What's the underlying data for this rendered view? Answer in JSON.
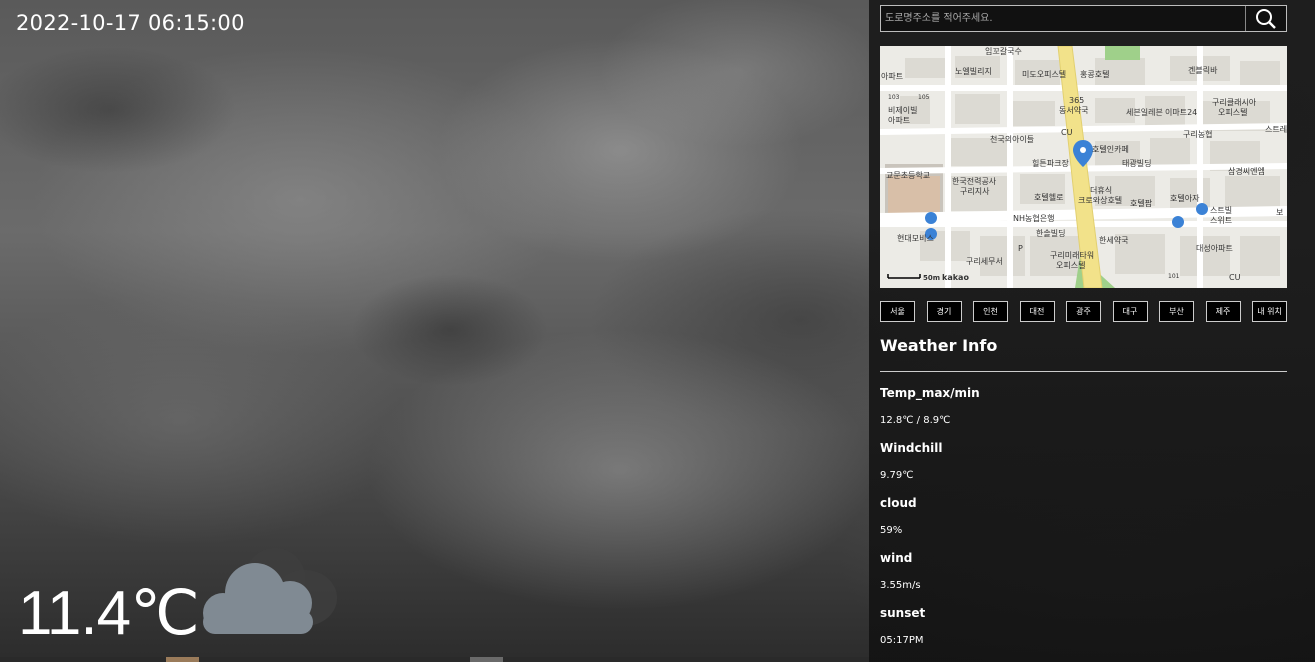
{
  "datetime": "2022-10-17 06:15:00",
  "current": {
    "temperature": "11.4℃",
    "icon": "cloud-icon"
  },
  "search": {
    "placeholder": "도로명주소를 적어주세요.",
    "icon": "search-icon"
  },
  "map": {
    "scale_label": "50m",
    "brand": "kakao",
    "labels": {
      "l1": "아파트",
      "l2": "노엘빌리지",
      "l3": "미도오피스텔",
      "l4": "홍콩호텔",
      "l5": "겐블릭바",
      "l6": "비제이빌",
      "l6b": "아파트",
      "l7": "365",
      "l7b": "동서약국",
      "l8": "세븐일레븐",
      "l9": "이마트24",
      "l10": "구리클래시아",
      "l10b": "오피스텔",
      "l11": "천국의아이들",
      "l12": "CU",
      "l13": "구리농협",
      "l14": "스트레",
      "l15": "호텔인카페",
      "l16": "교문초등학교",
      "l17": "힐튼파크장",
      "l18": "태광빌딩",
      "l19": "삼경씨엔엠",
      "l20": "한국전력공사",
      "l20b": "구리지사",
      "l21": "호텔헬로",
      "l22": "더휴식",
      "l22b": "크로와상호텔",
      "l23": "호텔팝",
      "l24": "호텔아자",
      "l25": "스트빌",
      "l25b": "스위트",
      "l26": "NH농협은행",
      "l27": "현대모비스",
      "l28": "한솔빌딩",
      "l29": "한세약국",
      "l30": "대성아파트",
      "l31": "구리세무서",
      "l32": "구리미래타워",
      "l32b": "오피스텔",
      "l33": "P",
      "l34": "CU",
      "l35": "103",
      "l36": "105",
      "l37": "101",
      "l38": "보",
      "l39": "임꼬갈국수"
    }
  },
  "regions": [
    "서울",
    "경기",
    "인천",
    "대전",
    "광주",
    "대구",
    "부산",
    "제주",
    "내 위치"
  ],
  "weather_info": {
    "title": "Weather Info",
    "items": [
      {
        "label": "Temp_max/min",
        "value": "12.8℃ / 8.9℃"
      },
      {
        "label": "Windchill",
        "value": "9.79℃"
      },
      {
        "label": "cloud",
        "value": "59%"
      },
      {
        "label": "wind",
        "value": "3.55m/s"
      },
      {
        "label": "sunset",
        "value": "05:17PM"
      }
    ]
  },
  "colors": {
    "icon_cloud_front": "#808a93",
    "icon_cloud_back": "#3e3e3e",
    "map_pin": "#3b82d6",
    "map_road": "#f2e28a"
  }
}
